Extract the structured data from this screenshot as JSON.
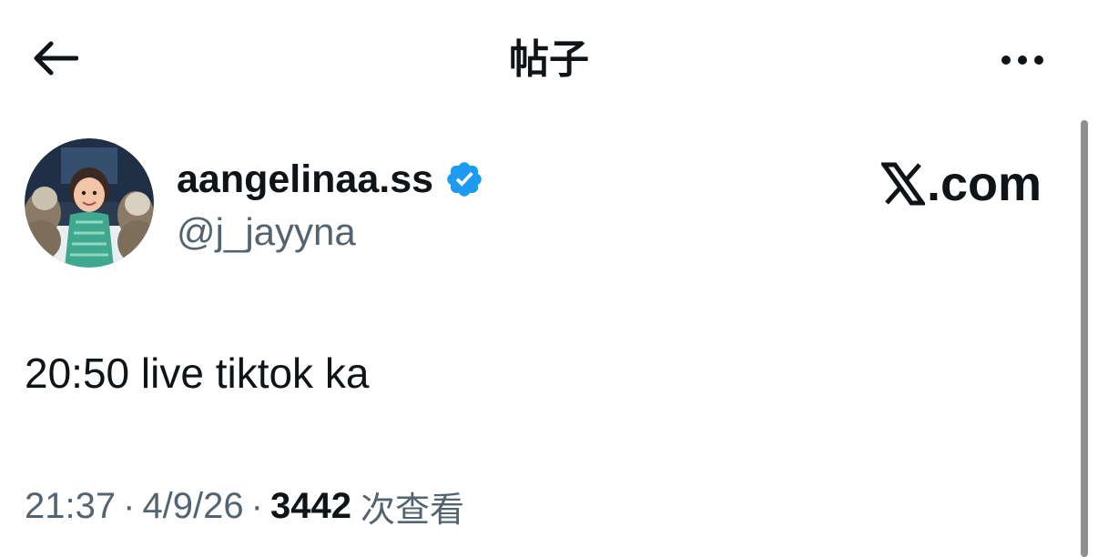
{
  "header": {
    "title": "帖子",
    "back_icon": "arrow-left-icon",
    "more_icon": "more-horizontal-icon"
  },
  "post": {
    "author": {
      "display_name": "aangelinaa.ss",
      "handle": "@j_jayyna",
      "verified": true,
      "verified_color": "#1d9bf0",
      "avatar_icon": "avatar-photo"
    },
    "text": "20:50 live tiktok ka",
    "meta": {
      "time": "21:37",
      "separator": "·",
      "date": "4/9/26",
      "views_count": "3442",
      "views_label": "次查看"
    }
  },
  "watermark": {
    "logo": "x-logo-icon",
    "text": ".com"
  },
  "colors": {
    "text_primary": "#0f1419",
    "text_secondary": "#536471",
    "accent": "#1d9bf0",
    "background": "#ffffff"
  }
}
